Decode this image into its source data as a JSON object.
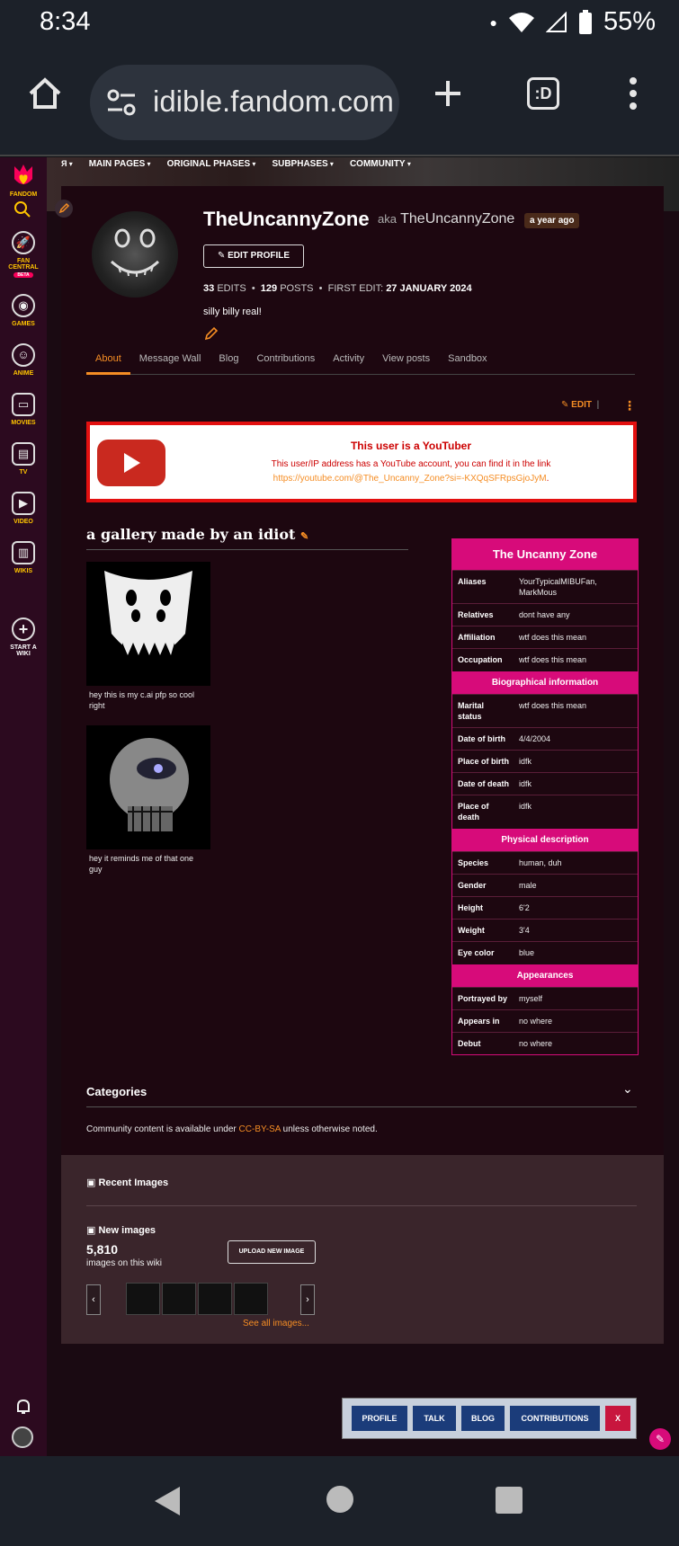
{
  "status_bar": {
    "time": "8:34",
    "battery": "55%"
  },
  "browser": {
    "url": "idible.fandom.com",
    "tab_switcher_label": ":D"
  },
  "rail": {
    "brand": "FANDOM",
    "items": [
      {
        "label": "FAN CENTRAL",
        "badge": "BETA"
      },
      {
        "label": "GAMES"
      },
      {
        "label": "ANIME"
      },
      {
        "label": "MOVIES"
      },
      {
        "label": "TV"
      },
      {
        "label": "VIDEO"
      },
      {
        "label": "WIKIS"
      },
      {
        "label": "START A WIKI"
      }
    ]
  },
  "wiki_nav": [
    "MAIN PAGES",
    "ORIGINAL PHASES",
    "SUBPHASES",
    "COMMUNITY"
  ],
  "profile": {
    "username": "TheUncannyZone",
    "aka_prefix": "aka",
    "aka": "TheUncannyZone",
    "joined": "a year ago",
    "edit_profile_label": "EDIT PROFILE",
    "edits_count": "33",
    "edits_label": "EDITS",
    "posts_count": "129",
    "posts_label": "POSTS",
    "first_edit_label": "FIRST EDIT:",
    "first_edit_date": "27 JANUARY 2024",
    "bio": "silly billy real!"
  },
  "tabs": [
    "About",
    "Message Wall",
    "Blog",
    "Contributions",
    "Activity",
    "View posts",
    "Sandbox"
  ],
  "active_tab": "About",
  "edit_label": "EDIT",
  "youtube_box": {
    "title": "This user is a YouTuber",
    "line1": "This user/IP address has a YouTube account, you can find it in the link",
    "link": "https://youtube.com/@The_Uncanny_Zone?si=-KXQqSFRpsGjoJyM",
    "link_suffix": "."
  },
  "gallery": {
    "title": "a gallery made by an idiot",
    "items": [
      {
        "caption": "hey this is my c.ai pfp so cool right"
      },
      {
        "caption": "hey it reminds me of that one guy"
      }
    ]
  },
  "infobox": {
    "title": "The Uncanny Zone",
    "rows1": [
      {
        "label": "Aliases",
        "value": "YourTypicalMIBUFan, MarkMous"
      },
      {
        "label": "Relatives",
        "value": "dont have any"
      },
      {
        "label": "Affiliation",
        "value": "wtf does this mean"
      },
      {
        "label": "Occupation",
        "value": "wtf does this mean"
      }
    ],
    "section2": "Biographical information",
    "rows2": [
      {
        "label": "Marital status",
        "value": "wtf does this mean"
      },
      {
        "label": "Date of birth",
        "value": "4/4/2004"
      },
      {
        "label": "Place of birth",
        "value": "idfk"
      },
      {
        "label": "Date of death",
        "value": "idfk"
      },
      {
        "label": "Place of death",
        "value": "idfk"
      }
    ],
    "section3": "Physical description",
    "rows3": [
      {
        "label": "Species",
        "value": "human, duh"
      },
      {
        "label": "Gender",
        "value": "male"
      },
      {
        "label": "Height",
        "value": "6'2"
      },
      {
        "label": "Weight",
        "value": "3'4"
      },
      {
        "label": "Eye color",
        "value": "blue"
      }
    ],
    "section4": "Appearances",
    "rows4": [
      {
        "label": "Portrayed by",
        "value": "myself"
      },
      {
        "label": "Appears in",
        "value": "no where"
      },
      {
        "label": "Debut",
        "value": "no where"
      }
    ]
  },
  "categories_label": "Categories",
  "license": {
    "prefix": "Community content is available under",
    "cc": "CC-BY-SA",
    "suffix": "unless otherwise noted."
  },
  "recent": {
    "title": "Recent Images",
    "new_images": "New images",
    "count": "5,810",
    "count_label": "images on this wiki",
    "upload_label": "UPLOAD NEW IMAGE",
    "see_all": "See all images..."
  },
  "floatbar": {
    "buttons": [
      "PROFILE",
      "TALK",
      "BLOG",
      "CONTRIBUTIONS",
      "X"
    ]
  },
  "colors": {
    "accent": "#f58d24",
    "infobox": "#d70b7a",
    "youtube_red": "#e31010"
  }
}
